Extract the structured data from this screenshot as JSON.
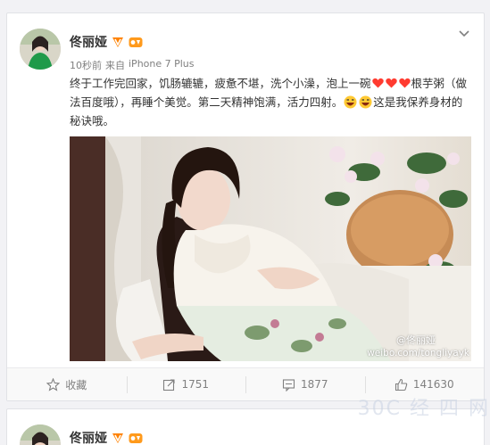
{
  "post1": {
    "author": "佟丽娅",
    "time": "10秒前",
    "source_prefix": "来自",
    "source": "iPhone 7 Plus",
    "text_part1": "终于工作完回家，饥肠辘辘，疲惫不堪，洗个小澡，泡上一碗",
    "text_part2": "根芋粥（做法百度哦），再睡个美觉。第二天精神饱满，活力四射。",
    "text_part3": "这是我保养身材的秘诀哦。",
    "watermark_user": "@佟丽娅",
    "watermark_url": "weibo.com/tongliyayk",
    "actions": {
      "favorite_label": "收藏",
      "repost_count": "1751",
      "comment_count": "1877",
      "like_count": "141630"
    }
  },
  "post2": {
    "author": "佟丽娅"
  },
  "site_watermark": "30C 经 四 网",
  "colors": {
    "accent_orange": "#ff8200",
    "heart_red": "#ff3b30",
    "text": "#333333",
    "muted": "#808080"
  },
  "icons": [
    "chevron-down-icon",
    "verified-icon",
    "vip-icon",
    "star-icon",
    "repost-icon",
    "comment-icon",
    "like-icon",
    "heart-emoji-icon",
    "laugh-emoji-icon"
  ]
}
